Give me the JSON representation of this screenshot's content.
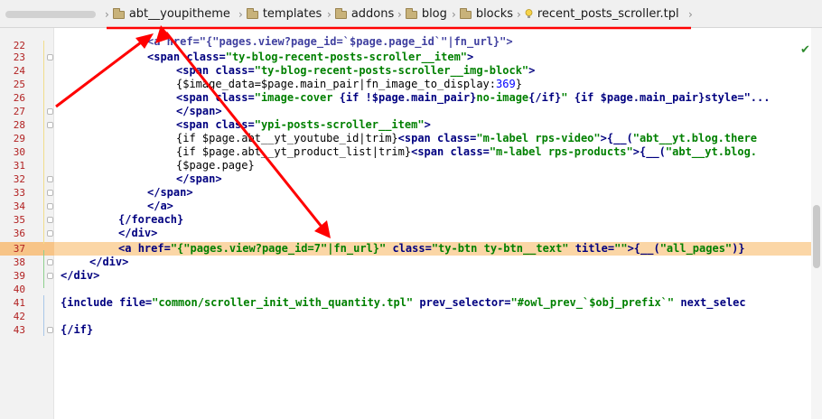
{
  "breadcrumb": {
    "items": [
      {
        "label": "abt__youpitheme"
      },
      {
        "label": "templates"
      },
      {
        "label": "addons"
      },
      {
        "label": "blog"
      },
      {
        "label": "blocks"
      },
      {
        "label": "recent_posts_scroller.tpl"
      }
    ]
  },
  "editor": {
    "line_numbers": [
      "22",
      "23",
      "24",
      "25",
      "26",
      "27",
      "28",
      "29",
      "30",
      "31",
      "32",
      "33",
      "34",
      "35",
      "36",
      "37",
      "38",
      "39",
      "40",
      "41",
      "42",
      "43"
    ],
    "highlighted_line": "37",
    "lines": {
      "l22": "<a href=\"{\"pages.view?page_id=`$page.page_id`\"|fn_url}\">",
      "l23a": "<span ",
      "l23b": "class=",
      "l23c": "\"ty-blog-recent-posts-scroller__item\"",
      "l23d": ">",
      "l24a": "<span ",
      "l24b": "class=",
      "l24c": "\"ty-blog-recent-posts-scroller__img-block\"",
      "l24d": ">",
      "l25a": "{$image_data=$page.main_pair|fn_image_to_display:",
      "l25b": "369",
      "l25c": "}",
      "l26a": "<span ",
      "l26b": "class=",
      "l26c": "\"image-cover ",
      "l26d": "{if !$page.main_pair}",
      "l26e": "no-image",
      "l26f": "{/if}",
      "l26g": "\" ",
      "l26h": "{if $page.main_pair}",
      "l26i": "style=\"...",
      "l27": "</span>",
      "l28a": "<span ",
      "l28b": "class=",
      "l28c": "\"ypi-posts-scroller__item\"",
      "l28d": ">",
      "l29a": "{if $page.abt__yt_youtube_id|trim}",
      "l29b": "<span ",
      "l29c": "class=",
      "l29d": "\"m-label rps-video\"",
      "l29e": ">{__(",
      "l29f": "\"abt__yt.blog.there",
      "l30a": "{if $page.abt__yt_product_list|trim}",
      "l30b": "<span ",
      "l30c": "class=",
      "l30d": "\"m-label rps-products\"",
      "l30e": ">{__(",
      "l30f": "\"abt__yt.blog.",
      "l31": "{$page.page}",
      "l32": "</span>",
      "l33": "</span>",
      "l34": "</a>",
      "l35": "{/foreach}",
      "l36": "</div>",
      "l37a": "<a ",
      "l37b": "href=",
      "l37c": "\"{\"pages.view?page_id=7\"|fn_url}\"",
      "l37d": " class=",
      "l37e": "\"ty-btn ty-btn__text\"",
      "l37f": " title=",
      "l37g": "\"\"",
      "l37h": ">{__(",
      "l37i": "\"all_pages\"",
      "l37j": ")}",
      "l38": "</div>",
      "l39": "</div>",
      "l41a": "{include ",
      "l41b": "file=",
      "l41c": "\"common/scroller_init_with_quantity.tpl\"",
      "l41d": " prev_selector=",
      "l41e": "\"#owl_prev_`$obj_prefix`\"",
      "l41f": " next_selec",
      "l43": "{/if}"
    }
  },
  "colors": {
    "highlight": "#fbd6a6",
    "annotation_red": "#ff0000",
    "line_number": "#b22222"
  },
  "icons": [
    "folder-icon",
    "tpl-file-icon",
    "check-icon"
  ]
}
